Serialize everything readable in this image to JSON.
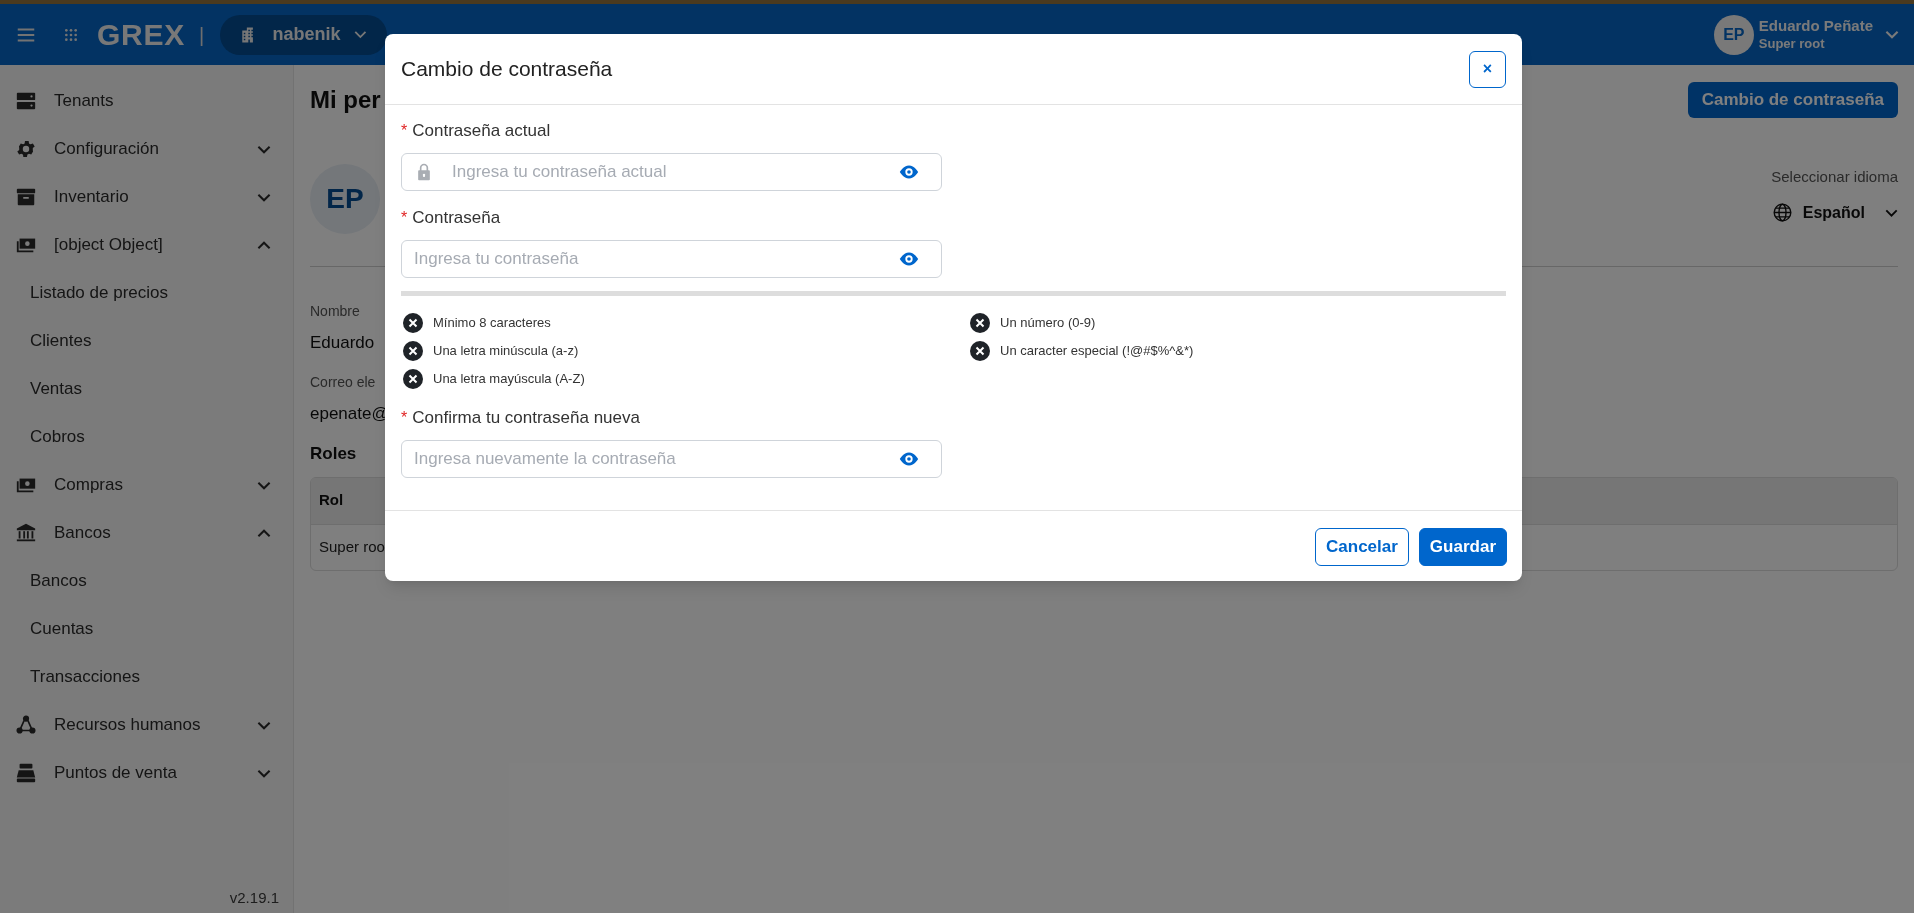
{
  "header": {
    "logo": "GREX",
    "separator": "|",
    "organization": "nabenik",
    "user": {
      "initials": "EP",
      "name": "Eduardo Peñate",
      "role": "Super root"
    }
  },
  "sidebar": {
    "items": [
      {
        "label": "Tenants"
      },
      {
        "label": "Configuración",
        "expanded": false
      },
      {
        "label": "Inventario",
        "expanded": false
      },
      {
        "label": "[object Object]",
        "expanded": true,
        "children": [
          {
            "label": "Listado de precios"
          },
          {
            "label": "Clientes"
          },
          {
            "label": "Ventas"
          },
          {
            "label": "Cobros"
          }
        ]
      },
      {
        "label": "Compras",
        "expanded": false
      },
      {
        "label": "Bancos",
        "expanded": true,
        "children": [
          {
            "label": "Bancos"
          },
          {
            "label": "Cuentas"
          },
          {
            "label": "Transacciones"
          }
        ]
      },
      {
        "label": "Recursos humanos",
        "expanded": false
      },
      {
        "label": "Puntos de venta",
        "expanded": false
      }
    ],
    "version": "v2.19.1"
  },
  "page": {
    "title": "Mi per",
    "action_button": "Cambio de contraseña",
    "avatar_initials": "EP",
    "language": {
      "label": "Seleccionar idioma",
      "value": "Español"
    },
    "fields": [
      {
        "label": "Nombre",
        "value": "Eduardo"
      },
      {
        "label": "Correo ele",
        "value": "epenate@"
      }
    ],
    "roles": {
      "title": "Roles",
      "columns": [
        "Rol"
      ],
      "rows": [
        [
          "Super roo"
        ]
      ]
    }
  },
  "dialog": {
    "title": "Cambio de contraseña",
    "close": "×",
    "fields": [
      {
        "required_mark": "*",
        "label": "Contraseña actual",
        "placeholder": "Ingresa tu contraseña actual",
        "kind": "locked"
      },
      {
        "required_mark": "*",
        "label": "Contraseña",
        "placeholder": "Ingresa tu contraseña",
        "kind": "plain"
      },
      {
        "required_mark": "*",
        "label": "Confirma tu contraseña nueva",
        "placeholder": "Ingresa nuevamente la contraseña",
        "kind": "plain"
      }
    ],
    "strength": {
      "level": 0
    },
    "requirements": [
      {
        "label": "Mínimo 8 caracteres",
        "met": false
      },
      {
        "label": "Un número (0-9)",
        "met": false
      },
      {
        "label": "Una letra minúscula (a-z)",
        "met": false
      },
      {
        "label": "Un caracter especial (!@#$%^&*)",
        "met": false
      },
      {
        "label": "Una letra mayúscula (A-Z)",
        "met": false
      }
    ],
    "buttons": [
      {
        "label": "Cancelar",
        "kind": "secondary"
      },
      {
        "label": "Guardar",
        "kind": "primary"
      }
    ]
  }
}
